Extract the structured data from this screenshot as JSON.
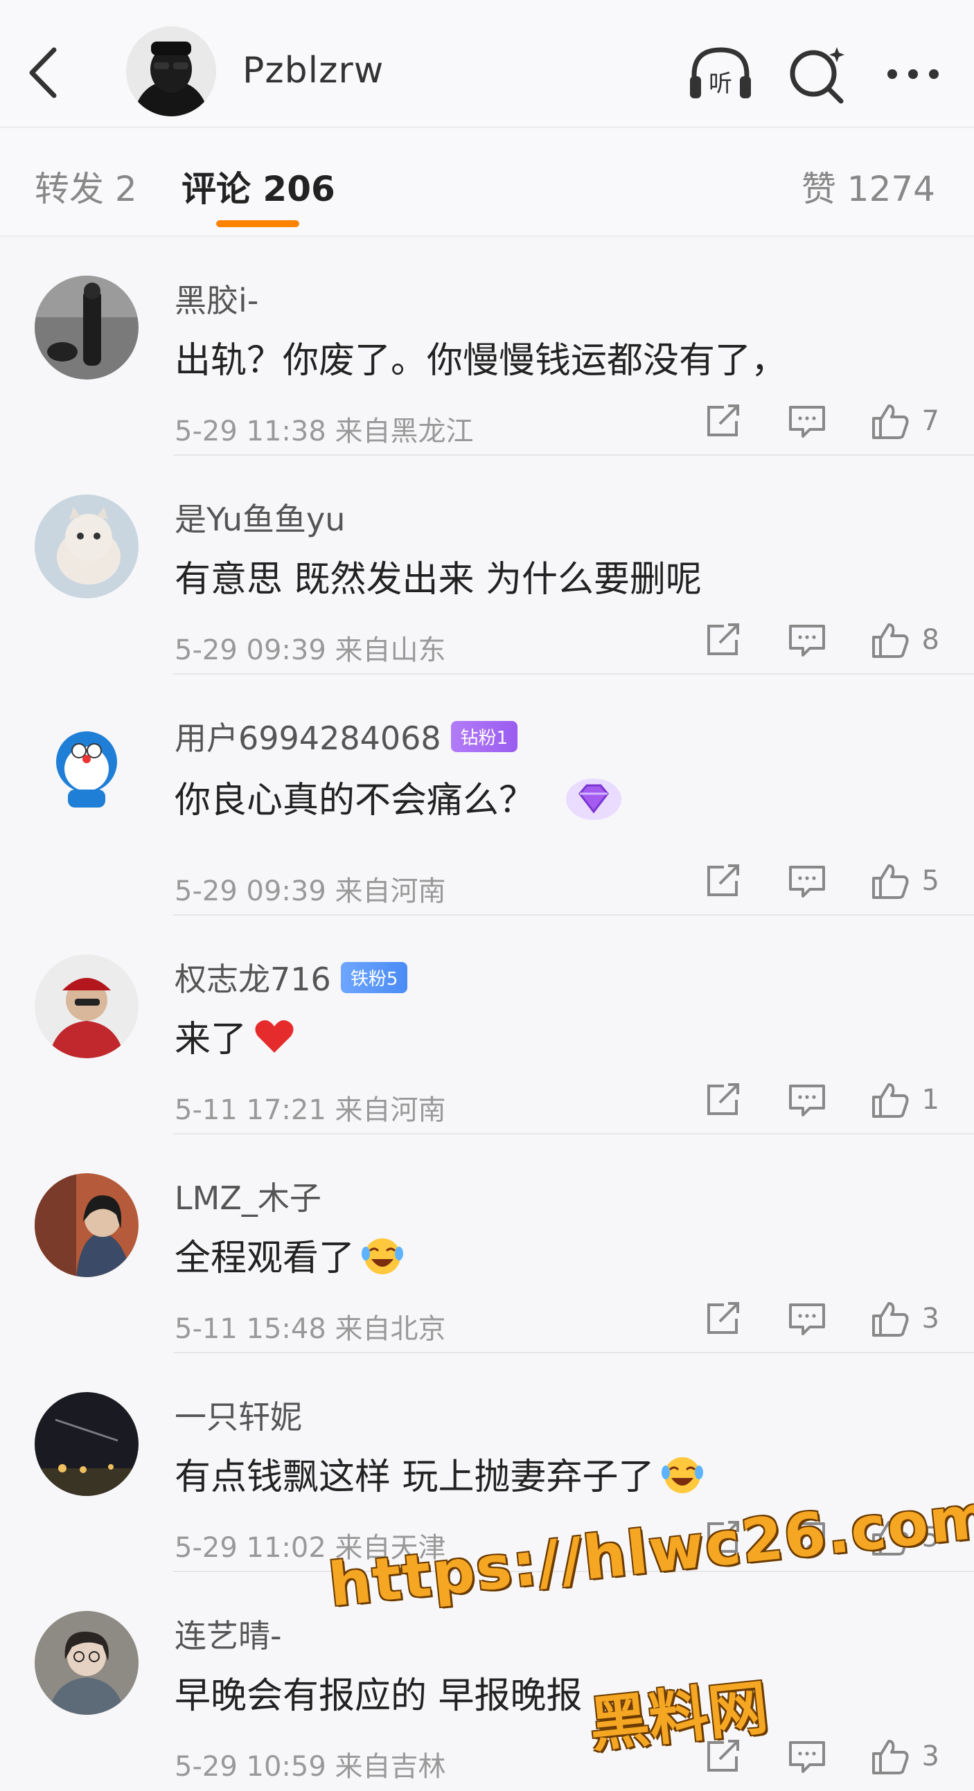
{
  "header": {
    "username": "Pzblzrw",
    "listen_label": "听",
    "icons": [
      "back-icon",
      "listen-headphones-icon",
      "search-icon",
      "more-icon"
    ]
  },
  "tabs": {
    "repost": "转发 2",
    "comments": "评论 206",
    "likes": "赞 1274",
    "active": "comments",
    "accent_color": "#ff8200"
  },
  "comments": [
    {
      "name": "黑胶i-",
      "badge": "",
      "text": "出轨？你废了。你慢慢钱运都没有了，",
      "time": "5-29 11:38",
      "location": "来自黑龙江",
      "likes": "7"
    },
    {
      "name": "是Yu鱼鱼yu",
      "badge": "",
      "text": "有意思 既然发出来 为什么要删呢",
      "time": "5-29 09:39",
      "location": "来自山东",
      "likes": "8"
    },
    {
      "name": "用户6994284068",
      "badge": "钻粉1",
      "text": "你良心真的不会痛么？",
      "time": "5-29 09:39",
      "location": "来自河南",
      "likes": "5"
    },
    {
      "name": "权志龙716",
      "badge": "铁粉5",
      "text": "来了",
      "time": "5-11 17:21",
      "location": "来自河南",
      "likes": "1"
    },
    {
      "name": "LMZ_木子",
      "badge": "",
      "text": "全程观看了",
      "time": "5-11 15:48",
      "location": "来自北京",
      "likes": "3"
    },
    {
      "name": "一只轩妮",
      "badge": "",
      "text": "有点钱飘这样 玩上抛妻弃子了",
      "time": "5-29 11:02",
      "location": "来自天津",
      "likes": "5"
    },
    {
      "name": "连艺晴-",
      "badge": "",
      "text": "早晚会有报应的 早报晚报",
      "time": "5-29 10:59",
      "location": "来自吉林",
      "likes": "3"
    }
  ],
  "watermark": {
    "url": "https://hlwc26.com",
    "name": "黑料网"
  }
}
